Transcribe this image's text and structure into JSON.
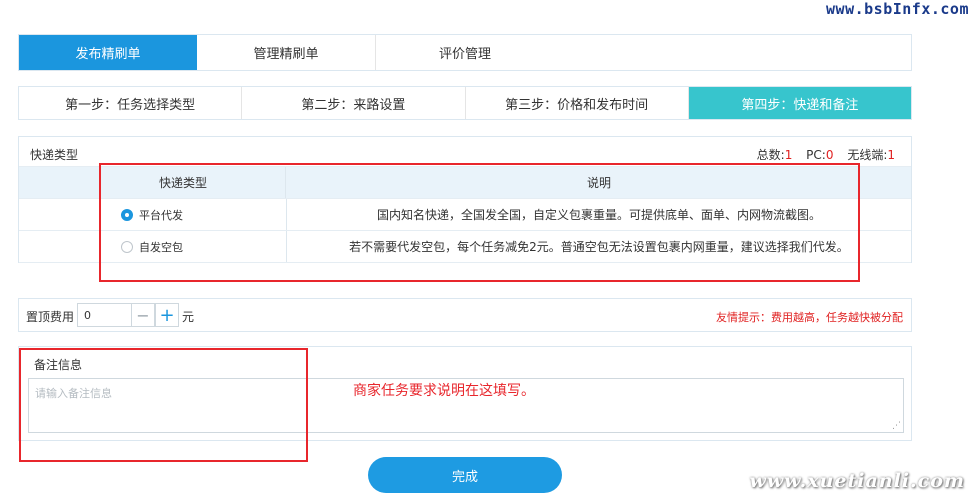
{
  "watermarks": {
    "top": "www.bsbInfx.com",
    "bottom": "www.xuetianli.com"
  },
  "top_tabs": [
    {
      "label": "发布精刷单",
      "active": true
    },
    {
      "label": "管理精刷单",
      "active": false
    },
    {
      "label": "评价管理",
      "active": false
    }
  ],
  "steps": [
    {
      "label": "第一步：任务选择类型",
      "active": false
    },
    {
      "label": "第二步：来路设置",
      "active": false
    },
    {
      "label": "第三步：价格和发布时间",
      "active": false
    },
    {
      "label": "第四步：快递和备注",
      "active": true
    }
  ],
  "express": {
    "title": "快递类型",
    "stats": {
      "total_label": "总数:",
      "total_value": "1",
      "pc_label": "PC:",
      "pc_value": "0",
      "wireless_label": "无线端:",
      "wireless_value": "1"
    },
    "table": {
      "headers": [
        "快递类型",
        "说明"
      ],
      "rows": [
        {
          "type": "平台代发",
          "checked": true,
          "desc": "国内知名快递，全国发全国，自定义包裹重量。可提供底单、面单、内网物流截图。"
        },
        {
          "type": "自发空包",
          "checked": false,
          "desc": "若不需要代发空包，每个任务减免2元。普通空包无法设置包裹内网重量，建议选择我们代发。"
        }
      ]
    }
  },
  "fee": {
    "label": "置顶费用",
    "value": "0",
    "minus": "−",
    "plus": "+",
    "unit": "元",
    "tip": "友情提示：费用越高，任务越快被分配"
  },
  "remark": {
    "title": "备注信息",
    "placeholder": "请输入备注信息",
    "note": "商家任务要求说明在这填写。"
  },
  "finish_label": "完成",
  "colors": {
    "primary": "#1b96de",
    "step_active": "#37c5cd",
    "annotation_red": "#e8262c"
  }
}
